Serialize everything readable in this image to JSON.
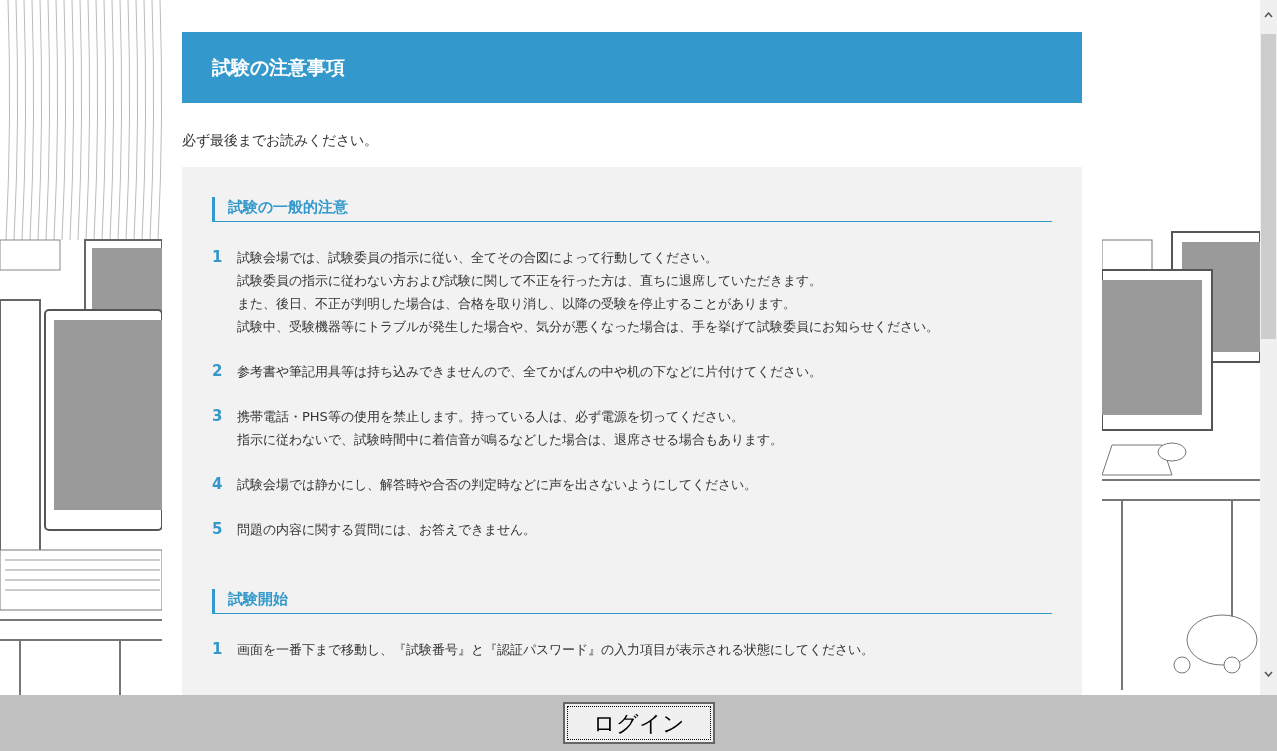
{
  "notice_title": "試験の注意事項",
  "intro": "必ず最後までお読みください。",
  "sections": [
    {
      "heading": "試験の一般的注意",
      "items": [
        {
          "number": "1",
          "lines": [
            "試験会場では、試験委員の指示に従い、全てその合図によって行動してください。",
            "試験委員の指示に従わない方および試験に関して不正を行った方は、直ちに退席していただきます。",
            "また、後日、不正が判明した場合は、合格を取り消し、以降の受験を停止することがあります。",
            "試験中、受験機器等にトラブルが発生した場合や、気分が悪くなった場合は、手を挙げて試験委員にお知らせください。"
          ]
        },
        {
          "number": "2",
          "lines": [
            "参考書や筆記用具等は持ち込みできませんので、全てかばんの中や机の下などに片付けてください。"
          ]
        },
        {
          "number": "3",
          "lines": [
            "携帯電話・PHS等の使用を禁止します。持っている人は、必ず電源を切ってください。",
            "指示に従わないで、試験時間中に着信音が鳴るなどした場合は、退席させる場合もあります。"
          ]
        },
        {
          "number": "4",
          "lines": [
            "試験会場では静かにし、解答時や合否の判定時などに声を出さないようにしてください。"
          ]
        },
        {
          "number": "5",
          "lines": [
            "問題の内容に関する質問には、お答えできません。"
          ]
        }
      ]
    },
    {
      "heading": "試験開始",
      "items": [
        {
          "number": "1",
          "lines": [
            "画面を一番下まで移動し、『試験番号』と『認証パスワード』の入力項目が表示される状態にしてください。"
          ]
        }
      ]
    }
  ],
  "login_button": "ログイン"
}
